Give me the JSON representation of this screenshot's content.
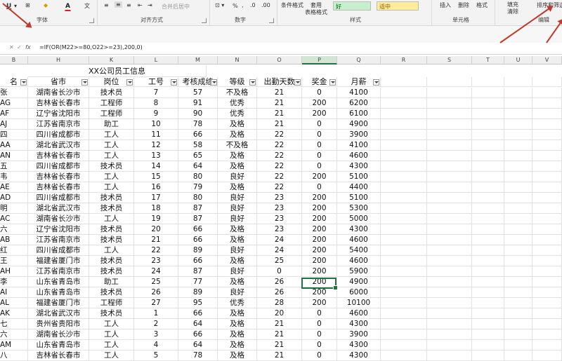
{
  "ribbon": {
    "font_group": "字体",
    "align_group": "对齐方式",
    "number_group": "数字",
    "styles_group": "样式",
    "cells_group": "单元格",
    "editing_group": "编辑",
    "merge_center": "合并后居中",
    "cond_format": "条件格式",
    "table_format_1": "套用",
    "table_format_2": "表格格式",
    "style_good": "好",
    "style_neutral": "适中",
    "insert": "插入",
    "delete": "删除",
    "format": "格式",
    "fill": "填充",
    "clear": "清除",
    "sort_filter": "排序和筛选",
    "underline": "U",
    "font_color": "A",
    "percent": "%"
  },
  "formula_bar": {
    "cancel": "✕",
    "enter": "✓",
    "fx": "fx",
    "formula": "=IF(OR(M22>=80,O22>=23),200,0)"
  },
  "columns": [
    "B",
    "H",
    "K",
    "L",
    "M",
    "N",
    "O",
    "P",
    "Q",
    "R",
    "S",
    "T",
    "U",
    "V"
  ],
  "sheet": {
    "title": "XX公司员工信息",
    "headers": [
      "名",
      "省市",
      "岗位",
      "工号",
      "考核成绩",
      "等级",
      "出勤天数",
      "奖金",
      "月薪"
    ],
    "rows": [
      [
        "张",
        "湖南省长沙市",
        "技术员",
        "7",
        "57",
        "不及格",
        "21",
        "0",
        "4100"
      ],
      [
        "AG",
        "吉林省长春市",
        "工程师",
        "8",
        "91",
        "优秀",
        "21",
        "200",
        "6200"
      ],
      [
        "AF",
        "辽宁省沈阳市",
        "工程师",
        "9",
        "90",
        "优秀",
        "21",
        "200",
        "6100"
      ],
      [
        "AJ",
        "江苏省南京市",
        "助工",
        "10",
        "78",
        "及格",
        "21",
        "0",
        "4900"
      ],
      [
        "四",
        "四川省成都市",
        "工人",
        "11",
        "66",
        "及格",
        "22",
        "0",
        "3900"
      ],
      [
        "AA",
        "湖北省武汉市",
        "工人",
        "12",
        "58",
        "不及格",
        "22",
        "0",
        "4100"
      ],
      [
        "AN",
        "吉林省长春市",
        "工人",
        "13",
        "65",
        "及格",
        "22",
        "0",
        "4600"
      ],
      [
        "五",
        "四川省成都市",
        "技术员",
        "14",
        "64",
        "及格",
        "22",
        "0",
        "4300"
      ],
      [
        "韦",
        "吉林省长春市",
        "工人",
        "15",
        "80",
        "良好",
        "22",
        "200",
        "5100"
      ],
      [
        "AE",
        "吉林省长春市",
        "工人",
        "16",
        "79",
        "及格",
        "22",
        "0",
        "4400"
      ],
      [
        "AD",
        "四川省成都市",
        "技术员",
        "17",
        "80",
        "良好",
        "23",
        "200",
        "5100"
      ],
      [
        "明",
        "湖北省武汉市",
        "技术员",
        "18",
        "87",
        "良好",
        "23",
        "200",
        "5300"
      ],
      [
        "AC",
        "湖南省长沙市",
        "工人",
        "19",
        "87",
        "良好",
        "23",
        "200",
        "5000"
      ],
      [
        "六",
        "辽宁省沈阳市",
        "技术员",
        "20",
        "66",
        "及格",
        "23",
        "200",
        "4300"
      ],
      [
        "AB",
        "江苏省南京市",
        "技术员",
        "21",
        "66",
        "及格",
        "24",
        "200",
        "4600"
      ],
      [
        "红",
        "四川省成都市",
        "工人",
        "22",
        "89",
        "良好",
        "24",
        "200",
        "5400"
      ],
      [
        "王",
        "福建省厦门市",
        "技术员",
        "23",
        "66",
        "及格",
        "25",
        "200",
        "4600"
      ],
      [
        "AH",
        "江苏省南京市",
        "技术员",
        "24",
        "87",
        "良好",
        "0",
        "200",
        "5900"
      ],
      [
        "李",
        "山东省青岛市",
        "助工",
        "25",
        "77",
        "及格",
        "26",
        "200",
        "4900"
      ],
      [
        "AI",
        "山东省青岛市",
        "技术员",
        "26",
        "89",
        "良好",
        "26",
        "200",
        "6000"
      ],
      [
        "AL",
        "福建省厦门市",
        "工程师",
        "27",
        "95",
        "优秀",
        "28",
        "200",
        "10100"
      ],
      [
        "AK",
        "湖北省武汉市",
        "技术员",
        "1",
        "66",
        "及格",
        "20",
        "0",
        "4600"
      ],
      [
        "七",
        "贵州省贵阳市",
        "工人",
        "2",
        "64",
        "及格",
        "21",
        "0",
        "4300"
      ],
      [
        "六",
        "湖南省长沙市",
        "工人",
        "3",
        "66",
        "及格",
        "21",
        "0",
        "3900"
      ],
      [
        "AM",
        "山东省青岛市",
        "工人",
        "4",
        "64",
        "及格",
        "21",
        "0",
        "4300"
      ],
      [
        "八",
        "吉林省长春市",
        "工人",
        "5",
        "78",
        "及格",
        "21",
        "0",
        "4300"
      ]
    ]
  },
  "colors": {
    "good_fill": "#c6efce",
    "good_text": "#006100",
    "neutral_fill": "#ffeb9c",
    "neutral_text": "#9c5700",
    "selection": "#217346",
    "annotation": "#c0392b"
  }
}
